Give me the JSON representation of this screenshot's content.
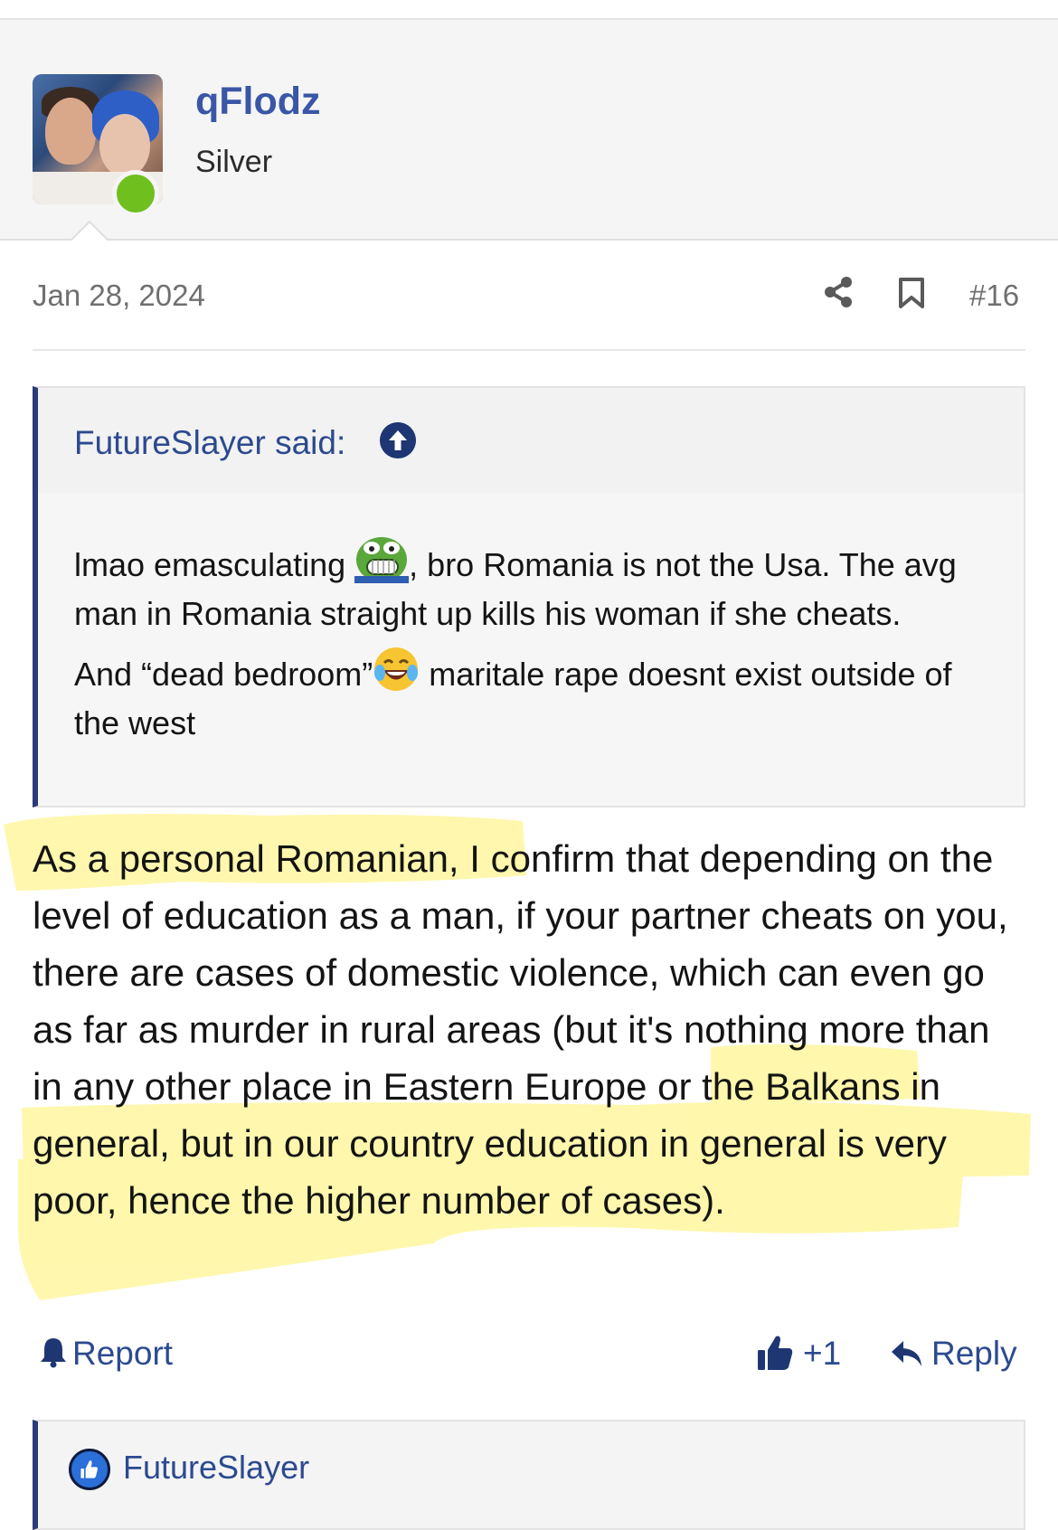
{
  "user": {
    "username": "qFlodz",
    "rank": "Silver",
    "online": true
  },
  "post": {
    "date": "Jan 28, 2024",
    "number": "#16",
    "quote": {
      "author_label": "FutureSlayer said:",
      "paragraph1_a": "lmao emasculating",
      "paragraph1_b": ", bro Romania is not the Usa. The avg man in Romania straight up kills his woman if she cheats.",
      "paragraph2_a": "And “dead bedroom”",
      "paragraph2_b": " maritale rape doesnt exist outside of the west"
    },
    "body_text": "As a personal Romanian, I confirm that depending on the level of education as a man, if your partner cheats on you, there are cases of domestic violence, which can even go as far as murder in rural areas (but it's nothing more than in any other place in Eastern Europe or the Balkans in general, but in our country education in general is very poor, hence the higher number of cases).",
    "highlight_color": "#fff48a"
  },
  "actions": {
    "report_label": "Report",
    "like_count": "+1",
    "reply_label": "Reply"
  },
  "reactions": {
    "users": "FutureSlayer"
  },
  "colors": {
    "link_blue": "#2c4a8f",
    "username_blue": "#3a56a6",
    "quote_border": "#2b3a78",
    "online_green": "#6fbf1e"
  },
  "icons": [
    "share-icon",
    "bookmark-icon",
    "arrow-up-icon",
    "pepe-emoji",
    "laughing-crying-emoji",
    "bell-icon",
    "thumbs-up-icon",
    "reply-arrow-icon",
    "like-badge-icon"
  ]
}
